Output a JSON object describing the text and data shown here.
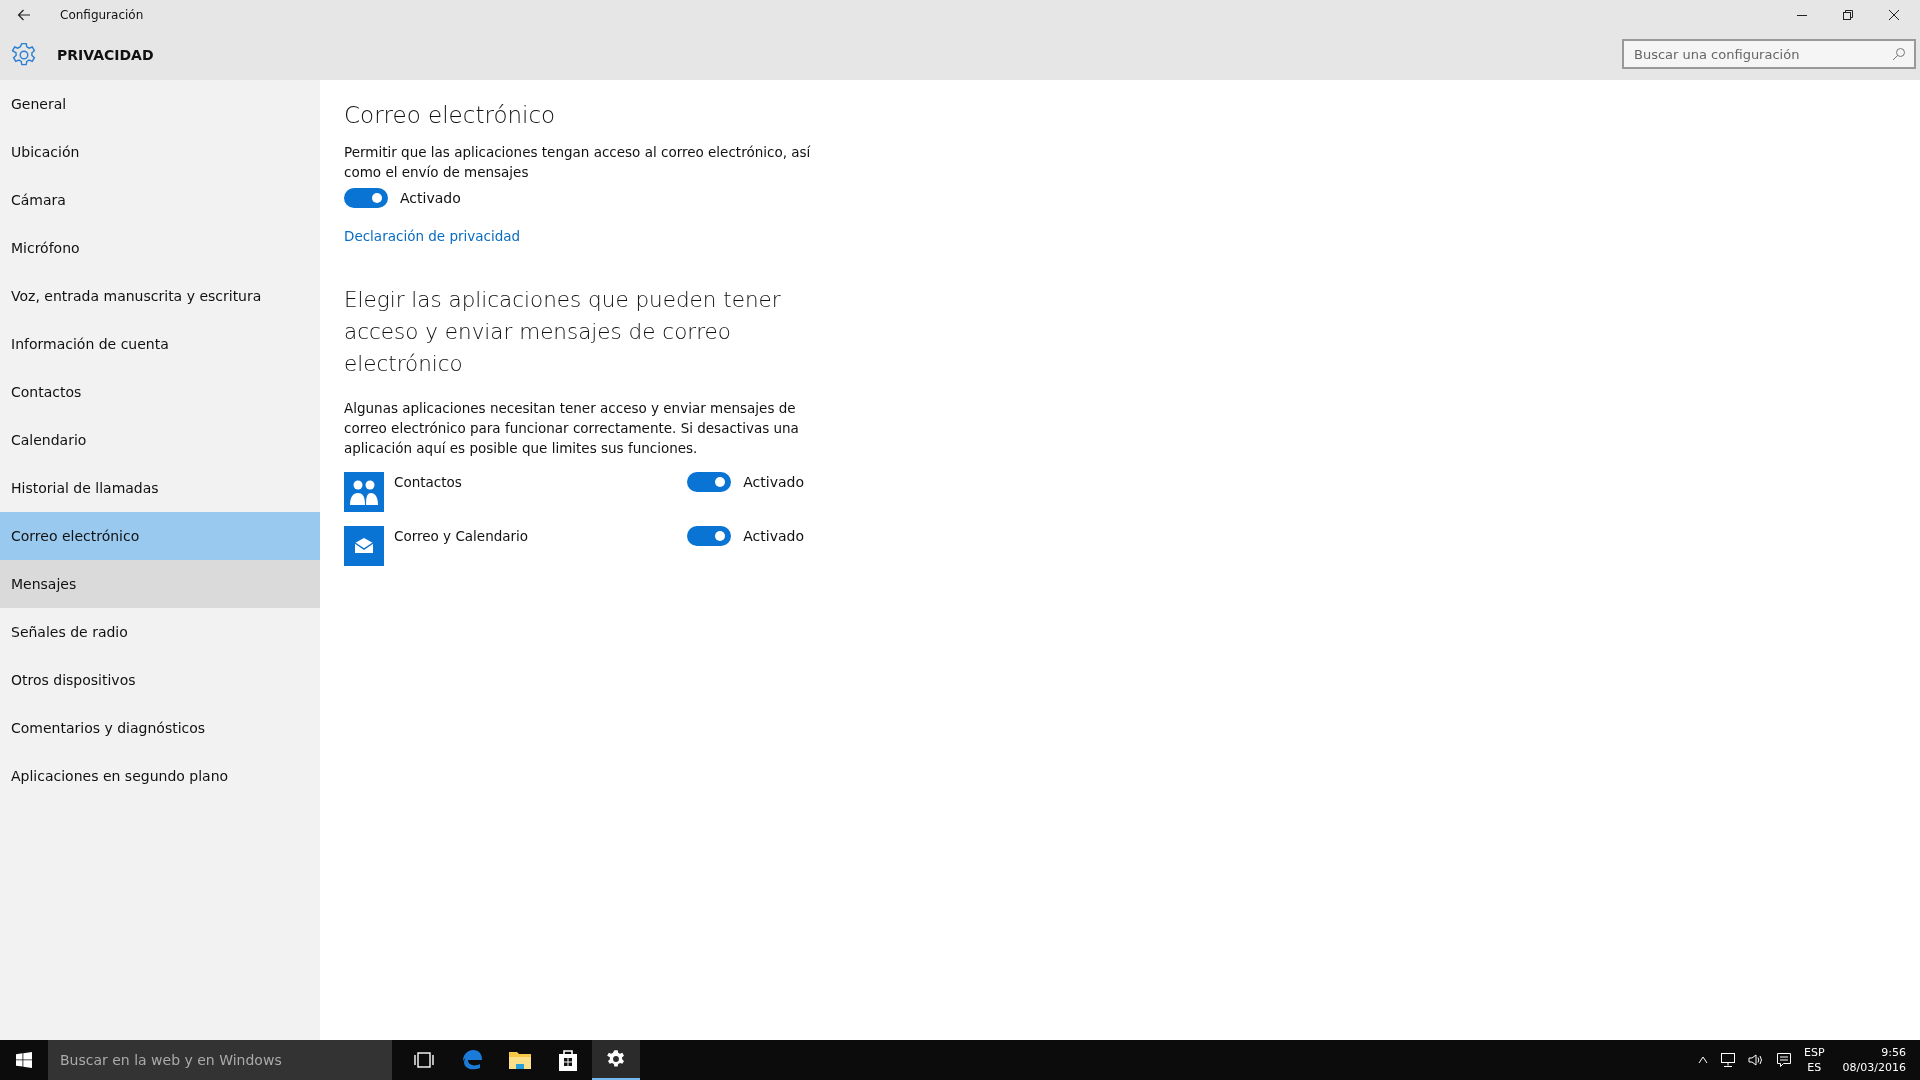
{
  "window": {
    "title": "Configuración"
  },
  "header": {
    "title": "PRIVACIDAD",
    "search": {
      "placeholder": "Buscar una configuración"
    }
  },
  "sidebar": {
    "items": [
      {
        "label": "General",
        "selected": false,
        "hovered": false
      },
      {
        "label": "Ubicación",
        "selected": false,
        "hovered": false
      },
      {
        "label": "Cámara",
        "selected": false,
        "hovered": false
      },
      {
        "label": "Micrófono",
        "selected": false,
        "hovered": false
      },
      {
        "label": "Voz, entrada manuscrita y escritura",
        "selected": false,
        "hovered": false
      },
      {
        "label": "Información de cuenta",
        "selected": false,
        "hovered": false
      },
      {
        "label": "Contactos",
        "selected": false,
        "hovered": false
      },
      {
        "label": "Calendario",
        "selected": false,
        "hovered": false
      },
      {
        "label": "Historial de llamadas",
        "selected": false,
        "hovered": false
      },
      {
        "label": "Correo electrónico",
        "selected": true,
        "hovered": false
      },
      {
        "label": "Mensajes",
        "selected": false,
        "hovered": true
      },
      {
        "label": "Señales de radio",
        "selected": false,
        "hovered": false
      },
      {
        "label": "Otros dispositivos",
        "selected": false,
        "hovered": false
      },
      {
        "label": "Comentarios y diagnósticos",
        "selected": false,
        "hovered": false
      },
      {
        "label": "Aplicaciones en segundo plano",
        "selected": false,
        "hovered": false
      }
    ]
  },
  "content": {
    "title": "Correo electrónico",
    "description": "Permitir que las aplicaciones tengan acceso al correo electrónico, así como el envío de mensajes",
    "main_toggle": {
      "on": true,
      "label": "Activado"
    },
    "link": "Declaración de privacidad",
    "apps_title": "Elegir las aplicaciones que pueden tener acceso y enviar mensajes de correo electrónico",
    "apps_description": "Algunas aplicaciones necesitan tener acceso y enviar mensajes de correo electrónico para funcionar correctamente. Si desactivas una aplicación aquí es posible que limites sus funciones.",
    "apps": [
      {
        "name": "Contactos",
        "kind": "people",
        "on": true,
        "label": "Activado"
      },
      {
        "name": "Correo y Calendario",
        "kind": "mail",
        "on": true,
        "label": "Activado"
      }
    ]
  },
  "taskbar": {
    "search": {
      "placeholder": "Buscar en la web y en Windows"
    },
    "apps": [
      {
        "kind": "taskview",
        "selected": false
      },
      {
        "kind": "edge",
        "selected": false
      },
      {
        "kind": "explorer",
        "selected": false
      },
      {
        "kind": "store",
        "selected": false
      },
      {
        "kind": "settings",
        "selected": true
      }
    ],
    "language": [
      "ESP",
      "ES"
    ],
    "time": "9:56",
    "date": "08/03/2016"
  }
}
